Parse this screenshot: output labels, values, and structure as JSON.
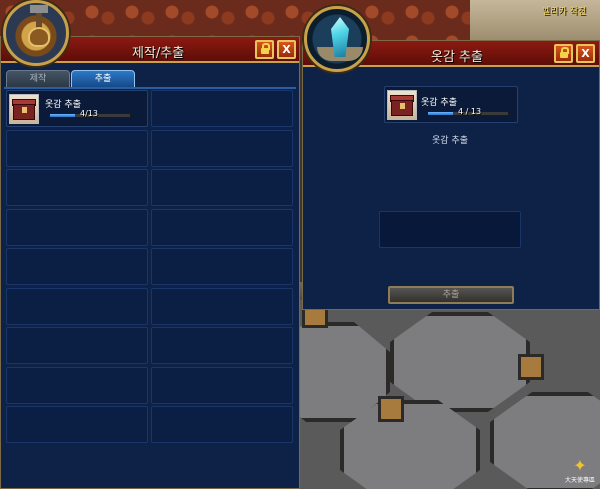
{
  "top_right_label": "벨리카 작전",
  "credit_badge": "大天使專區",
  "crafting_window": {
    "title": "제작/추출",
    "lock_icon": "lock-icon",
    "close_label": "X",
    "tabs": [
      {
        "label": "제작",
        "active": false
      },
      {
        "label": "추출",
        "active": true
      }
    ],
    "item": {
      "name": "옷감 추출",
      "progress_text": "4/13",
      "progress_fraction": 0.31
    }
  },
  "extract_window": {
    "title": "옷감 추출",
    "close_label": "X",
    "item": {
      "name": "옷감 추출",
      "progress_text": "4 / 13",
      "progress_fraction": 0.31
    },
    "label": "옷감 추출",
    "button_label": "추출"
  },
  "colors": {
    "panel_bg": "#0e2248",
    "titlebar": "#8c1a12",
    "accent_gold": "#c8a24a",
    "progress_fill": "#2a74c8"
  }
}
